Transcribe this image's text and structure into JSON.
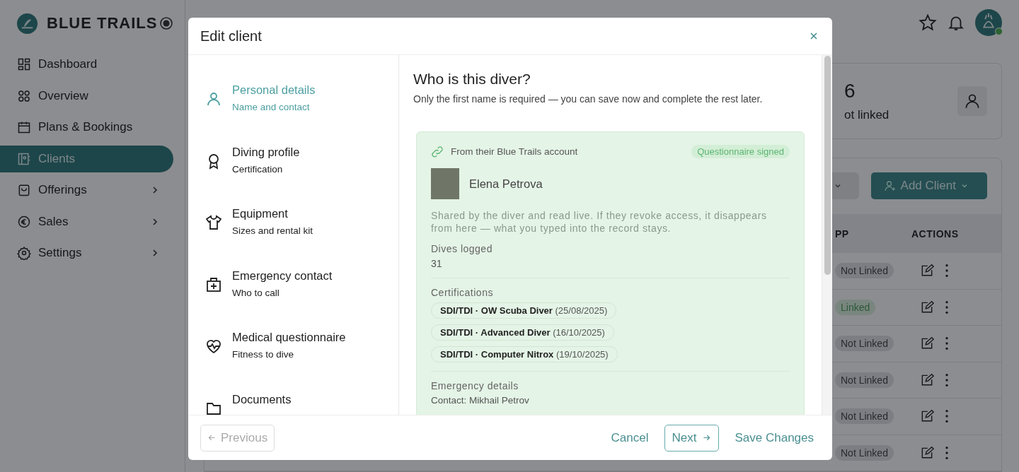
{
  "brand": {
    "name": "BLUE TRAILS"
  },
  "sidebar": {
    "items": [
      {
        "label": "Dashboard",
        "kind": "dashboard",
        "selected": false,
        "has_submenu": false
      },
      {
        "label": "Overview",
        "kind": "overview",
        "selected": false,
        "has_submenu": false
      },
      {
        "label": "Plans & Bookings",
        "kind": "calendar",
        "selected": false,
        "has_submenu": false
      },
      {
        "label": "Clients",
        "kind": "clients",
        "selected": true,
        "has_submenu": false
      },
      {
        "label": "Offerings",
        "kind": "bag",
        "selected": false,
        "has_submenu": true
      },
      {
        "label": "Sales",
        "kind": "euro",
        "selected": false,
        "has_submenu": true
      },
      {
        "label": "Settings",
        "kind": "gear",
        "selected": false,
        "has_submenu": true
      }
    ]
  },
  "header": {
    "avatar_online": true
  },
  "stat_card": {
    "value": "6",
    "label": "ot linked"
  },
  "toolbar": {
    "add_button": "Add Client"
  },
  "table": {
    "columns": [
      "PP",
      "ACTIONS"
    ],
    "rows": [
      {
        "status": "Not Linked",
        "linked": false
      },
      {
        "status": "Linked",
        "linked": true
      },
      {
        "status": "Not Linked",
        "linked": false
      },
      {
        "status": "Not Linked",
        "linked": false
      },
      {
        "status": "Not Linked",
        "linked": false
      },
      {
        "status": "Not Linked",
        "linked": false
      }
    ]
  },
  "dialog": {
    "title": "Edit client",
    "steps": [
      {
        "title": "Personal details",
        "subtitle": "Name and contact",
        "kind": "person",
        "selected": true
      },
      {
        "title": "Diving profile",
        "subtitle": "Certification",
        "kind": "award",
        "selected": false
      },
      {
        "title": "Equipment",
        "subtitle": "Sizes and rental kit",
        "kind": "shirt",
        "selected": false
      },
      {
        "title": "Emergency contact",
        "subtitle": "Who to call",
        "kind": "firstaid",
        "selected": false
      },
      {
        "title": "Medical questionnaire",
        "subtitle": "Fitness to dive",
        "kind": "heart",
        "selected": false
      },
      {
        "title": "Documents",
        "kind": "folder",
        "selected": false
      }
    ],
    "heading": "Who is this diver?",
    "intro": "Only the first name is required — you can save now and complete the rest later.",
    "account_card": {
      "source": "From their Blue Trails account",
      "badge": "Questionnaire signed",
      "name": "Elena Petrova",
      "note": "Shared by the diver and read live. If they revoke access, it disappears from here — what you typed into the record stays.",
      "dives_label": "Dives logged",
      "dives_value": "31",
      "certifications_label": "Certifications",
      "certifications": [
        {
          "name": "SDI/TDI · OW Scuba Diver",
          "date": "(25/08/2025)"
        },
        {
          "name": "SDI/TDI · Advanced Diver",
          "date": "(16/10/2025)"
        },
        {
          "name": "SDI/TDI · Computer Nitrox",
          "date": "(19/10/2025)"
        }
      ],
      "emergency_label": "Emergency details",
      "emergency_contact": "Contact: Mikhail Petrov"
    },
    "buttons": {
      "previous": "Previous",
      "previous_disabled": true,
      "cancel": "Cancel",
      "next": "Next",
      "save": "Save Changes"
    }
  }
}
